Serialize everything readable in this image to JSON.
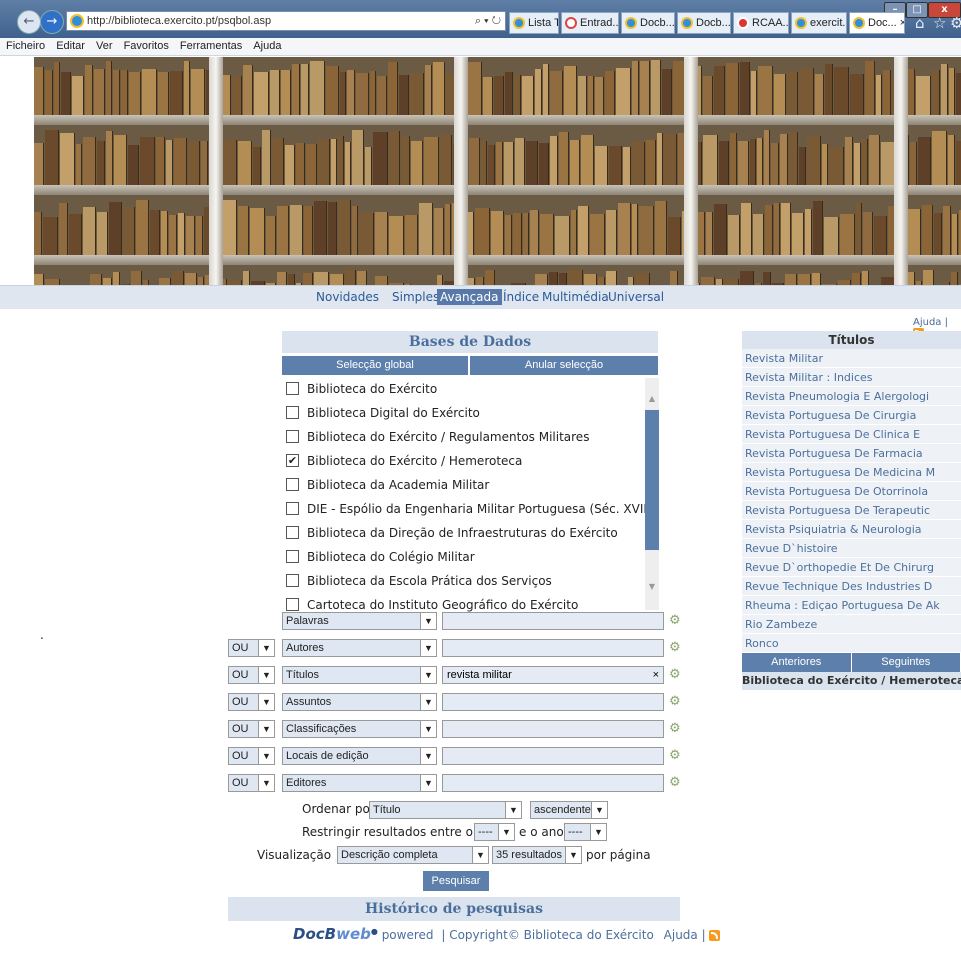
{
  "browser": {
    "url": "http://biblioteca.exercito.pt/psqbol.asp",
    "tabs": [
      "Lista T...",
      "Entrad...",
      "Docb...",
      "Docb...",
      "RCAA...",
      "exercit...",
      "Doc..."
    ],
    "menu": [
      "Ficheiro",
      "Editar",
      "Ver",
      "Favoritos",
      "Ferramentas",
      "Ajuda"
    ]
  },
  "nav": {
    "items": [
      "Novidades",
      "Simples",
      "Avançada",
      "Índice",
      "Multimédia",
      "Universal"
    ],
    "active": "Avançada"
  },
  "help_link": "Ajuda |",
  "bases": {
    "title": "Bases de Dados",
    "select_all": "Selecção global",
    "clear_all": "Anular selecção",
    "items": [
      {
        "label": "Biblioteca do Exército",
        "checked": false
      },
      {
        "label": "Biblioteca Digital do Exército",
        "checked": false
      },
      {
        "label": "Biblioteca do Exército / Regulamentos Militares",
        "checked": false
      },
      {
        "label": "Biblioteca do Exército / Hemeroteca",
        "checked": true
      },
      {
        "label": "Biblioteca da Academia Militar",
        "checked": false
      },
      {
        "label": "DIE - Espólio da Engenharia Militar Portuguesa (Séc. XVIII)",
        "checked": false
      },
      {
        "label": "Biblioteca da Direção de Infraestruturas do Exército",
        "checked": false
      },
      {
        "label": "Biblioteca do Colégio Militar",
        "checked": false
      },
      {
        "label": "Biblioteca da Escola Prática dos Serviços",
        "checked": false
      },
      {
        "label": "Cartoteca do Instituto Geográfico do Exército",
        "checked": false
      }
    ]
  },
  "search_rows": [
    {
      "op": "",
      "field": "Palavras",
      "value": ""
    },
    {
      "op": "OU",
      "field": "Autores",
      "value": ""
    },
    {
      "op": "OU",
      "field": "Títulos",
      "value": "revista militar"
    },
    {
      "op": "OU",
      "field": "Assuntos",
      "value": ""
    },
    {
      "op": "OU",
      "field": "Classificações",
      "value": ""
    },
    {
      "op": "OU",
      "field": "Locais de edição",
      "value": ""
    },
    {
      "op": "OU",
      "field": "Editores",
      "value": ""
    }
  ],
  "options": {
    "sort_label": "Ordenar por",
    "sort_value": "Título",
    "sort_dir": "ascendente",
    "restrict_label": "Restringir resultados entre o ano",
    "year_from": "----",
    "and_year_label": "e o ano",
    "year_to": "----",
    "view_label": "Visualização",
    "view_value": "Descrição completa",
    "per_page_value": "35 resultados",
    "per_page_label": "por página"
  },
  "search_button": "Pesquisar",
  "history_title": "Histórico de pesquisas",
  "footer": {
    "logo_a": "DocB",
    "logo_b": "web",
    "powered": "powered",
    "copyright": "| Copyright© Biblioteca do Exército",
    "help": "Ajuda |"
  },
  "titulos": {
    "title": "Títulos",
    "items": [
      "Revista Militar",
      "Revista Militar : Indices",
      "Revista Pneumologia E Alergologi",
      "Revista Portuguesa De Cirurgia",
      "Revista Portuguesa De Clinica E",
      "Revista Portuguesa De Farmacia",
      "Revista Portuguesa De Medicina M",
      "Revista Portuguesa De Otorrinola",
      "Revista Portuguesa De Terapeutic",
      "Revista Psiquiatria & Neurologia",
      "Revue D`histoire",
      "Revue D`orthopedie Et De Chirurg",
      "Revue Technique Des Industries D",
      "Rheuma : Ediçao Portuguesa De Ak",
      "Rio Zambeze",
      "Ronco"
    ],
    "prev": "Anteriores",
    "next": "Seguintes",
    "database": "Biblioteca do Exército / Hemeroteca"
  },
  "dot": "."
}
